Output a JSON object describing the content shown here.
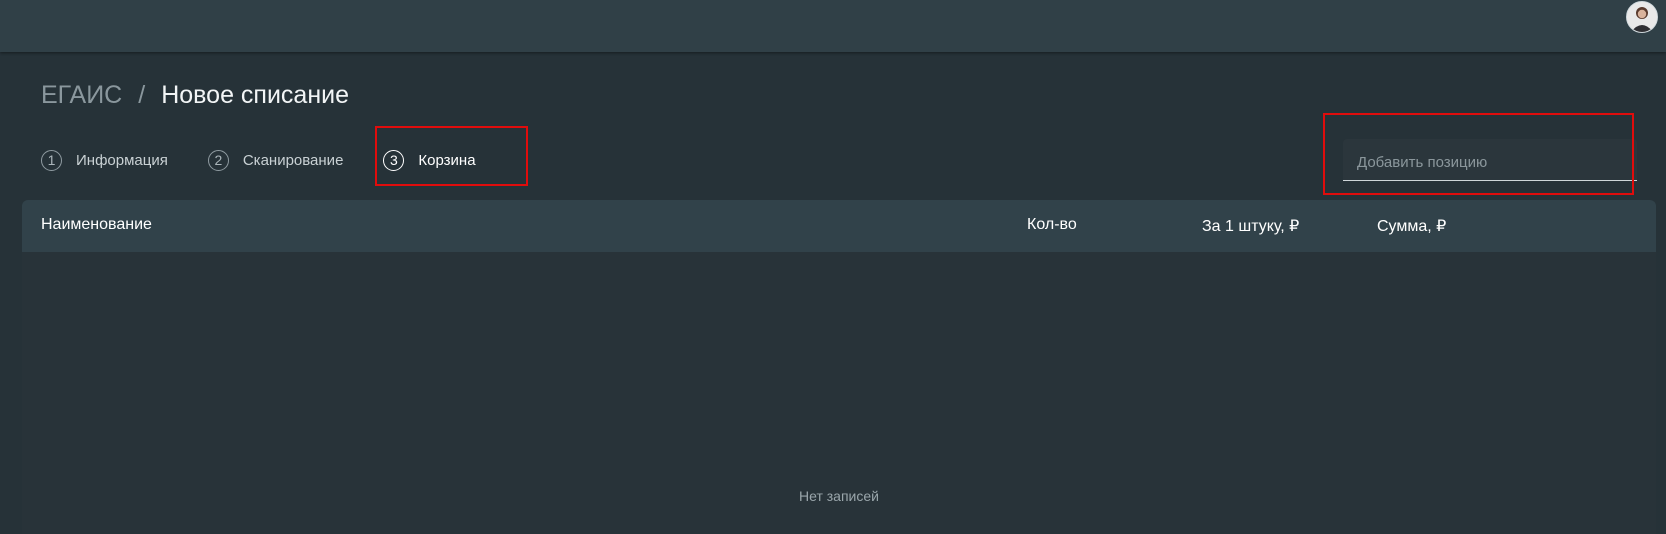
{
  "breadcrumb": {
    "root": "ЕГАИС",
    "separator": "/",
    "current": "Новое списание"
  },
  "steps": [
    {
      "number": "1",
      "label": "Информация",
      "active": false
    },
    {
      "number": "2",
      "label": "Сканирование",
      "active": false
    },
    {
      "number": "3",
      "label": "Корзина",
      "active": true
    }
  ],
  "add_position": {
    "placeholder": "Добавить позицию",
    "value": ""
  },
  "table": {
    "columns": [
      "Наименование",
      "Кол-во",
      "За 1 штуку, ₽",
      "Сумма, ₽"
    ],
    "rows": [],
    "empty_text": "Нет записей"
  },
  "header": {
    "avatar_icon": "user-avatar"
  },
  "colors": {
    "background": "#263238",
    "topbar": "#304047",
    "table_header": "#31424a",
    "highlight": "#e10c0c"
  }
}
